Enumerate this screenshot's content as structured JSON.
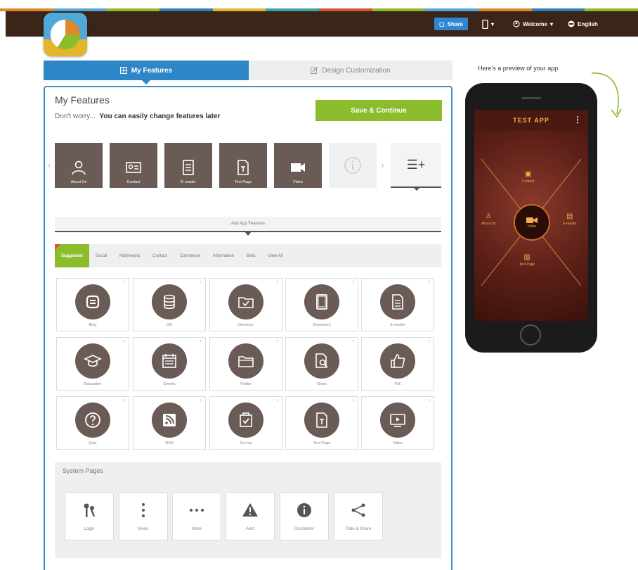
{
  "header": {
    "share_label": "Share",
    "welcome_label": "Welcome",
    "language_label": "English"
  },
  "tabs": {
    "features": "My Features",
    "design": "Design Customization"
  },
  "main": {
    "title": "My Features",
    "subtitle_prefix": "Don't worry...",
    "subtitle_bold": "You can easily change features later",
    "save_button": "Save & Continue",
    "add_features_label": "Add App Features"
  },
  "selected_features": [
    {
      "label": "About Us",
      "icon": "person-icon"
    },
    {
      "label": "Contact",
      "icon": "contact-card-icon"
    },
    {
      "label": "E-reader",
      "icon": "document-icon"
    },
    {
      "label": "Text Page",
      "icon": "text-page-icon"
    },
    {
      "label": "Video",
      "icon": "video-camera-icon"
    }
  ],
  "categories": [
    "Suggested",
    "Social",
    "Multimedia",
    "Contact",
    "Commerce",
    "Information",
    "Beta",
    "View All"
  ],
  "feature_grid": [
    {
      "label": "Blog",
      "icon": "blogger-icon"
    },
    {
      "label": "DB",
      "icon": "database-icon"
    },
    {
      "label": "Directory",
      "icon": "folder-check-icon"
    },
    {
      "label": "Document",
      "icon": "tablet-icon"
    },
    {
      "label": "E-reader",
      "icon": "document-icon"
    },
    {
      "label": "Education",
      "icon": "graduation-cap-icon"
    },
    {
      "label": "Events",
      "icon": "calendar-icon"
    },
    {
      "label": "Folder",
      "icon": "folder-icon"
    },
    {
      "label": "News",
      "icon": "news-search-icon"
    },
    {
      "label": "Poll",
      "icon": "thumbs-up-icon"
    },
    {
      "label": "Quiz",
      "icon": "question-icon"
    },
    {
      "label": "RSS",
      "icon": "rss-icon"
    },
    {
      "label": "Survey",
      "icon": "survey-icon"
    },
    {
      "label": "Text Page",
      "icon": "text-page-icon"
    },
    {
      "label": "Video",
      "icon": "video-play-icon"
    }
  ],
  "system_pages": {
    "title": "System Pages",
    "items": [
      {
        "label": "Login",
        "icon": "keys-icon"
      },
      {
        "label": "Menu",
        "icon": "vertical-dots-icon"
      },
      {
        "label": "More",
        "icon": "horizontal-dots-icon"
      },
      {
        "label": "Alert",
        "icon": "warning-icon"
      },
      {
        "label": "Disclaimer",
        "icon": "info-icon"
      },
      {
        "label": "Rate & Share",
        "icon": "share-icon"
      }
    ]
  },
  "preview": {
    "label": "Here's a preview of your app",
    "app_title": "TEST APP",
    "hub_label": "Video",
    "spokes": [
      "Contact",
      "About Us",
      "E-reader",
      "Text Page"
    ]
  },
  "colors": {
    "header_bg": "#3b2418",
    "accent_blue": "#2f86c6",
    "accent_green": "#8bbc2c",
    "icon_brown": "#6b5b56",
    "stripe": [
      "#e2882c",
      "#4fa8d8",
      "#8bbc2c",
      "#2f7fc1",
      "#e2b52c",
      "#3aa6a8",
      "#d4572e",
      "#8bbc2c",
      "#4fa8d8",
      "#e2882c",
      "#2f7fc1",
      "#8bbc2c"
    ]
  }
}
